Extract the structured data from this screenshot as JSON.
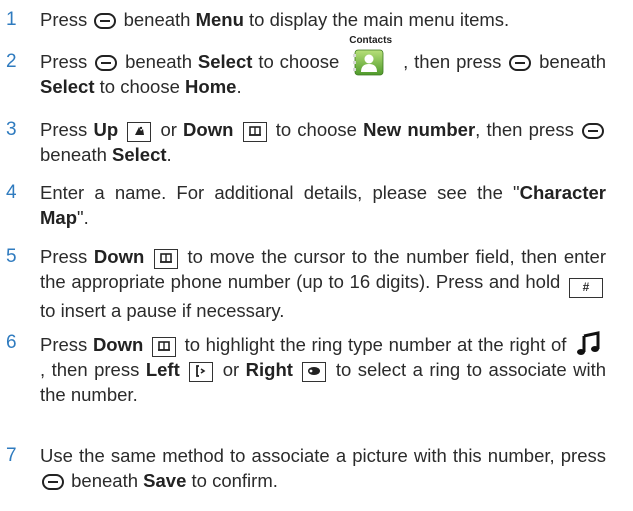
{
  "steps": [
    {
      "number": "1",
      "parts": {
        "a": "Press",
        "b": "beneath",
        "menu": "Menu",
        "c": "to display the main menu items."
      }
    },
    {
      "number": "2",
      "parts": {
        "a": "Press",
        "b": "beneath",
        "select": "Select",
        "c": "to choose",
        "contacts_caption": "Contacts",
        "d": ", then press",
        "e": "beneath",
        "select2": "Select",
        "f": "to choose",
        "home": "Home",
        "g": "."
      }
    },
    {
      "number": "3",
      "parts": {
        "a": "Press",
        "up": "Up",
        "b": "or",
        "down": "Down",
        "c": "to choose",
        "newnum": "New number",
        "d": ", then press",
        "e": "beneath",
        "select": "Select",
        "f": "."
      }
    },
    {
      "number": "4",
      "parts": {
        "a": "Enter a name. For additional details, please see the \"",
        "charmap": "Character Map",
        "b": "\"."
      }
    },
    {
      "number": "5",
      "parts": {
        "a": "Press",
        "down": "Down",
        "b": "to move the cursor to the number field, then enter the appropriate phone number (up to 16 digits). Press and hold",
        "key": "#",
        "c": "to insert a pause if necessary."
      }
    },
    {
      "number": "6",
      "parts": {
        "a": "Press",
        "down": "Down",
        "b": "to highlight the ring type number at the right of",
        "c": ", then press",
        "left": "Left",
        "d": "or",
        "right": "Right",
        "e": "to select a ring to associate with the number."
      }
    },
    {
      "number": "7",
      "parts": {
        "a": "Use the same method to associate a picture with this number, press",
        "b": "beneath",
        "save": "Save",
        "c": "to confirm."
      }
    }
  ],
  "icons": {
    "up_key": "up-arrow-key-icon",
    "down_key": "down-arrow-key-icon",
    "left_key": "left-arrow-key-icon",
    "right_key": "right-arrow-key-icon",
    "ring_icon": "music-note-icon",
    "contacts_icon": "contacts-icon"
  },
  "colors": {
    "step_number": "#2f7bbf",
    "text": "#2b2b2b"
  }
}
